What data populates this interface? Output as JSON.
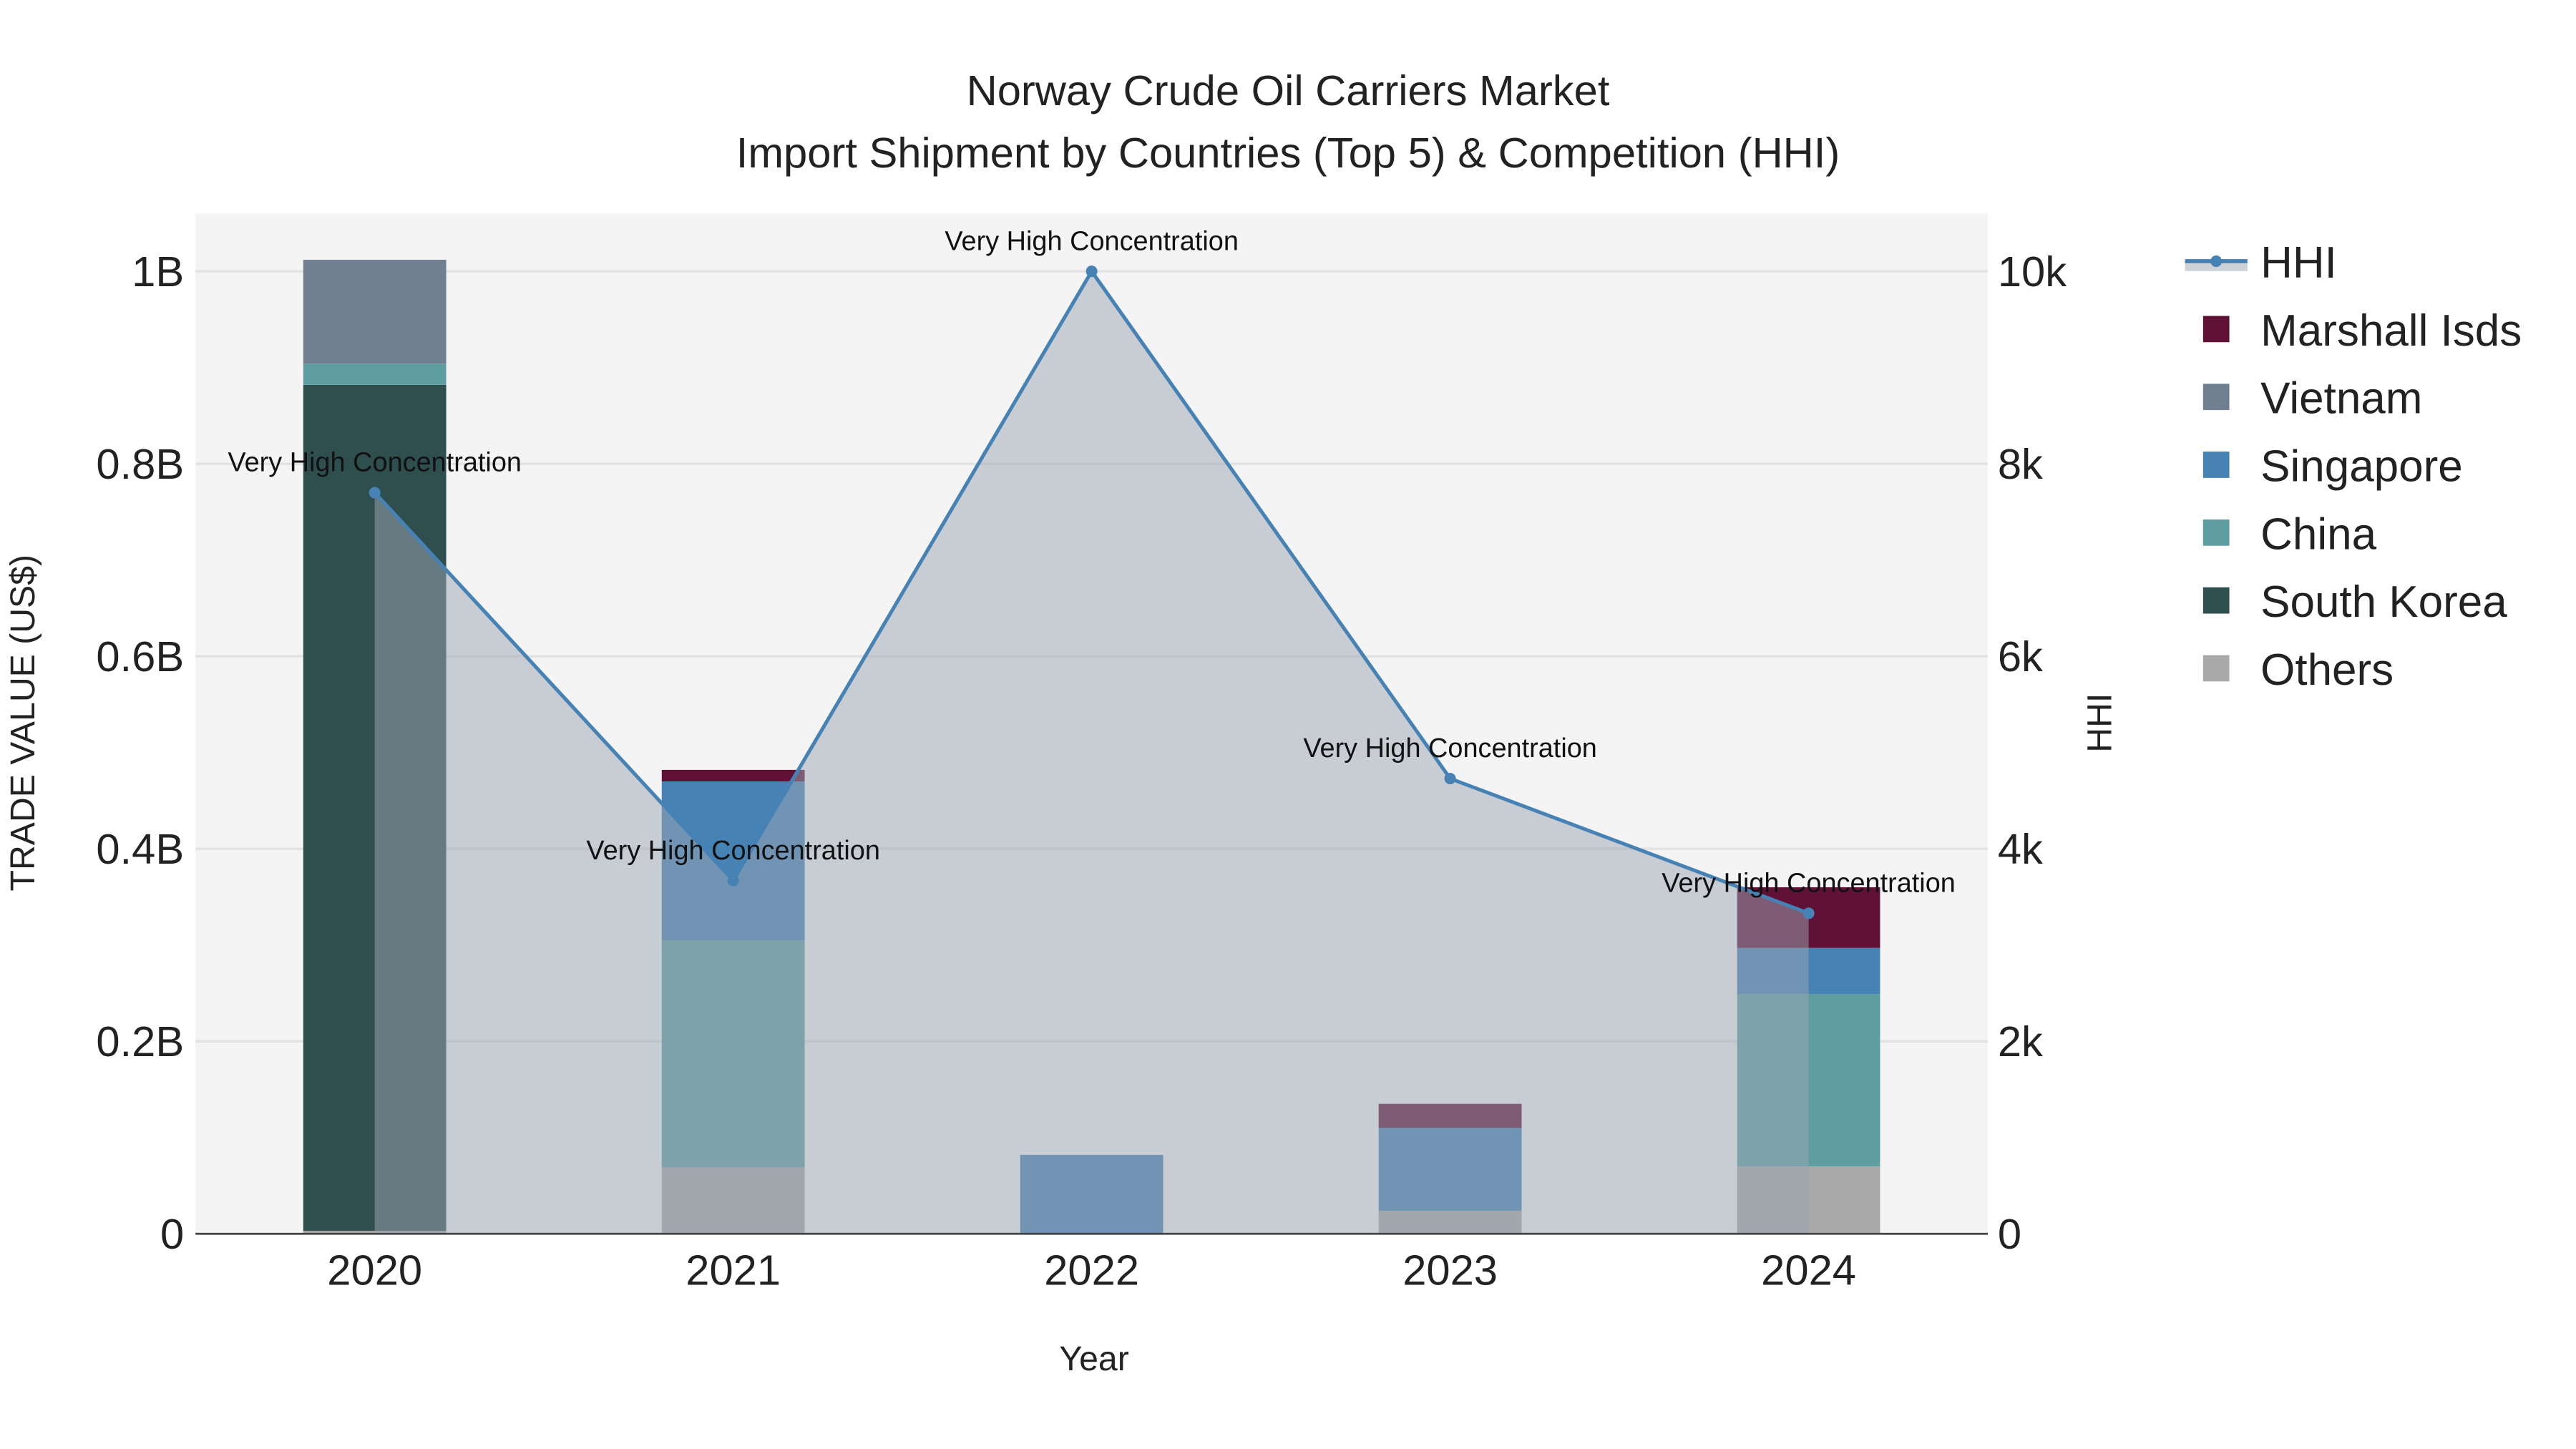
{
  "chart_data": {
    "type": "bar",
    "title": "Norway Crude Oil Carriers Market",
    "subtitle": "Import Shipment by Countries (Top 5) & Competition (HHI)",
    "xlabel": "Year",
    "ylabel": "TRADE VALUE (US$)",
    "y2label": "HHI",
    "categories": [
      "2020",
      "2021",
      "2022",
      "2023",
      "2024"
    ],
    "ylim": [
      0,
      1.06
    ],
    "y_unit": "B",
    "yticks": [
      {
        "v": 0,
        "label": "0"
      },
      {
        "v": 0.2,
        "label": "0.2B"
      },
      {
        "v": 0.4,
        "label": "0.4B"
      },
      {
        "v": 0.6,
        "label": "0.6B"
      },
      {
        "v": 0.8,
        "label": "0.8B"
      },
      {
        "v": 1,
        "label": "1B"
      }
    ],
    "y2lim": [
      0,
      10600
    ],
    "y2ticks": [
      {
        "v": 0,
        "label": "0"
      },
      {
        "v": 2000,
        "label": "2k"
      },
      {
        "v": 4000,
        "label": "4k"
      },
      {
        "v": 6000,
        "label": "6k"
      },
      {
        "v": 8000,
        "label": "8k"
      },
      {
        "v": 10000,
        "label": "10k"
      }
    ],
    "series": [
      {
        "name": "Others",
        "color": "#a9a9a9",
        "values": [
          0.003,
          0.069,
          0,
          0.024,
          0.07
        ]
      },
      {
        "name": "South Korea",
        "color": "#2f4f4f",
        "values": [
          0.879,
          0,
          0,
          0,
          0
        ]
      },
      {
        "name": "China",
        "color": "#5f9ea0",
        "values": [
          0.022,
          0.236,
          0,
          0,
          0.179
        ]
      },
      {
        "name": "Singapore",
        "color": "#4682b4",
        "values": [
          0,
          0.165,
          0.082,
          0.086,
          0.048
        ]
      },
      {
        "name": "Vietnam",
        "color": "#708090",
        "values": [
          0.108,
          0,
          0,
          0,
          0
        ]
      },
      {
        "name": "Marshall Isds",
        "color": "#601236",
        "values": [
          0,
          0.012,
          0,
          0.025,
          0.063
        ]
      }
    ],
    "hhi": {
      "name": "HHI",
      "color": "#4682b4",
      "values": [
        7700,
        3670,
        10000,
        4730,
        3330
      ],
      "annotations": [
        "Very High Concentration",
        "Very High Concentration",
        "Very High Concentration",
        "Very High Concentration",
        "Very High Concentration"
      ]
    },
    "legend_order": [
      "HHI",
      "Marshall Isds",
      "Vietnam",
      "Singapore",
      "China",
      "South Korea",
      "Others"
    ],
    "legend_position": "right",
    "grid": true
  }
}
